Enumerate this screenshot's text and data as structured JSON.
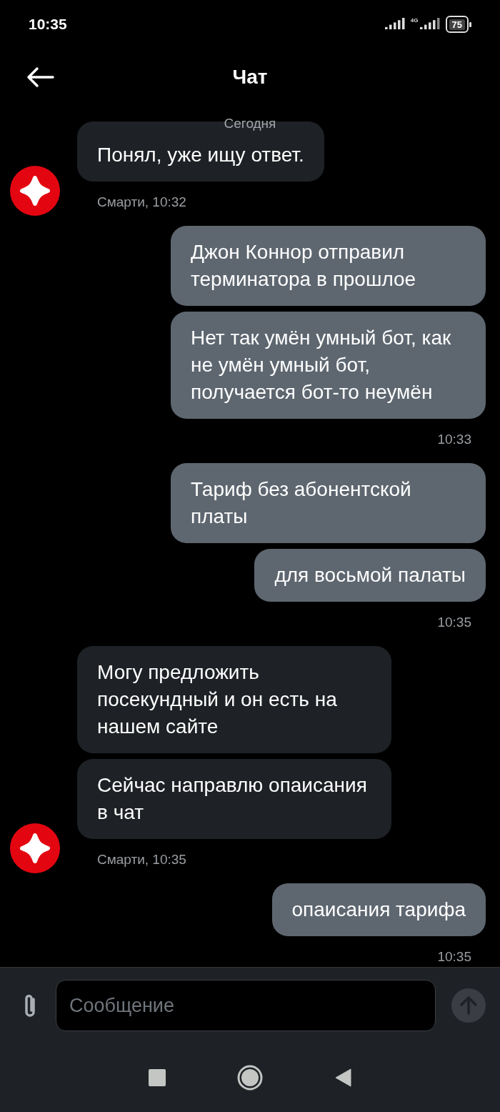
{
  "status_bar": {
    "time": "10:35",
    "network": "4G",
    "battery": "75"
  },
  "header": {
    "title": "Чат"
  },
  "date_label": "Сегодня",
  "groups": [
    {
      "kind": "incoming",
      "bubbles": [
        "Понял, уже ищу ответ."
      ],
      "meta": "Смарти, 10:32"
    },
    {
      "kind": "outgoing",
      "bubbles": [
        "Джон Коннор отправил терминатора в прошлое",
        "Нет так умён умный бот, как не умён умный бот, получается бот-то неумён"
      ],
      "meta": "10:33"
    },
    {
      "kind": "outgoing",
      "bubbles": [
        "Тариф без абонентской платы",
        "для восьмой палаты"
      ],
      "meta": "10:35"
    },
    {
      "kind": "incoming",
      "bubbles": [
        "Могу предложить посекундный и он есть на нашем сайте",
        "Сейчас направлю опаисания в чат"
      ],
      "meta": "Смарти, 10:35"
    },
    {
      "kind": "outgoing",
      "bubbles": [
        "опаисания тарифа"
      ],
      "meta": "10:35"
    }
  ],
  "composer": {
    "placeholder": "Сообщение"
  }
}
